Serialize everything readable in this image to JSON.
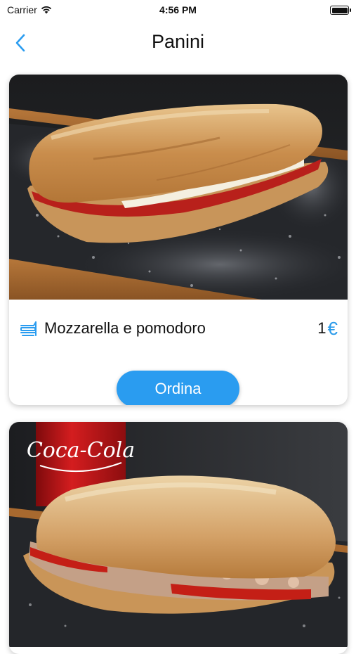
{
  "status_bar": {
    "carrier": "Carrier",
    "time": "4:56 PM"
  },
  "nav": {
    "title": "Panini"
  },
  "products": [
    {
      "name": "Mozzarella e pomodoro",
      "price": "1",
      "currency": "€",
      "order_label": "Ordina"
    },
    {
      "can_label": "Coca-Cola"
    }
  ],
  "colors": {
    "accent": "#2a9cf0",
    "text": "#111111"
  }
}
